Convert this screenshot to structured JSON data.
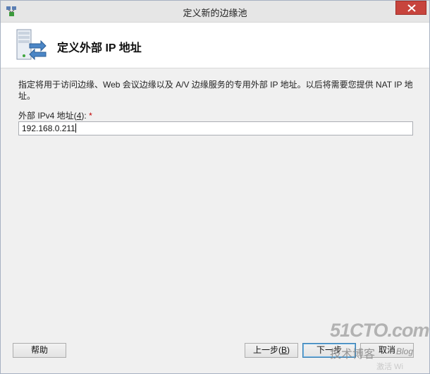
{
  "window": {
    "title": "定义新的边缘池",
    "close_symbol": "✕"
  },
  "header": {
    "title": "定义外部 IP 地址",
    "icon": "server-arrows-icon"
  },
  "main": {
    "description": "指定将用于访问边缘、Web 会议边缘以及 A/V 边缘服务的专用外部 IP 地址。以后将需要您提供 NAT IP 地址。",
    "field_label_prefix": "外部 IPv4 地址(",
    "field_label_hotkey": "4",
    "field_label_suffix": "):",
    "required_mark": "*",
    "ipv4_value": "192.168.0.211"
  },
  "buttons": {
    "help": "帮助",
    "prev_prefix": "上一步(",
    "prev_hotkey": "B",
    "prev_suffix": ")",
    "next": "下一步",
    "cancel": "取消"
  },
  "watermark": {
    "main": "51CTO.com",
    "sub": "技术博客",
    "blog": "Blog",
    "extra": "激活 Wi"
  },
  "colors": {
    "close_button": "#c7443d",
    "required": "#c00000",
    "default_button_border": "#3c7fb1"
  }
}
